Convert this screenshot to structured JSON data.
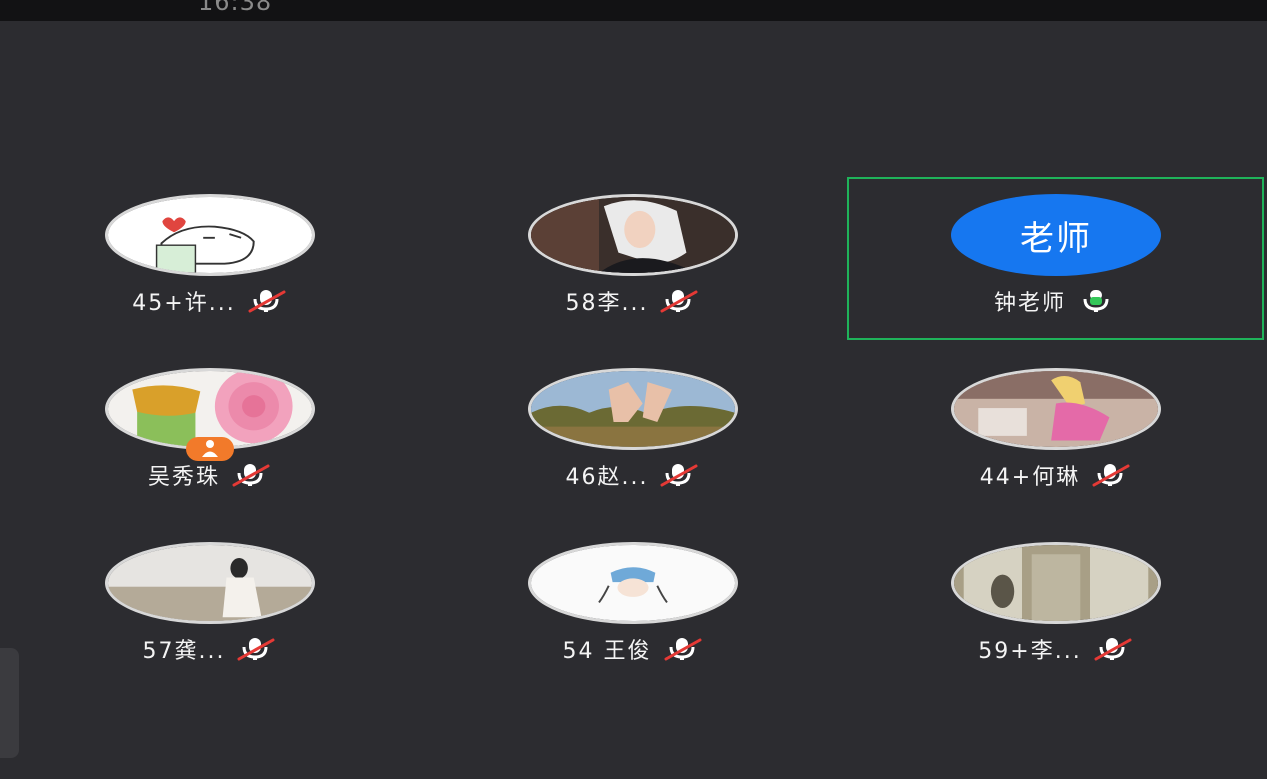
{
  "status_bar": {
    "time": "16:38"
  },
  "participants": [
    {
      "name": "45+许...",
      "mic": "muted"
    },
    {
      "name": "58李...",
      "mic": "muted"
    },
    {
      "name": "钟老师",
      "mic": "active",
      "avatar_text": "老师"
    },
    {
      "name": "吴秀珠",
      "mic": "muted"
    },
    {
      "name": "46赵...",
      "mic": "muted"
    },
    {
      "name": "44+何琳",
      "mic": "muted"
    },
    {
      "name": "57龚...",
      "mic": "muted"
    },
    {
      "name": "54 王俊",
      "mic": "muted"
    },
    {
      "name": "59+李...",
      "mic": "muted"
    }
  ],
  "colors": {
    "background": "#2c2c30",
    "selected_border": "#1fb35a",
    "teacher_avatar": "#1677f0",
    "host_badge": "#f27a2a",
    "mic_active": "#34c759",
    "mic_muted_slash": "#e53935"
  },
  "icons": {
    "mic_muted": "microphone-muted-icon",
    "mic_active": "microphone-active-icon",
    "host_badge": "person-badge-icon"
  }
}
